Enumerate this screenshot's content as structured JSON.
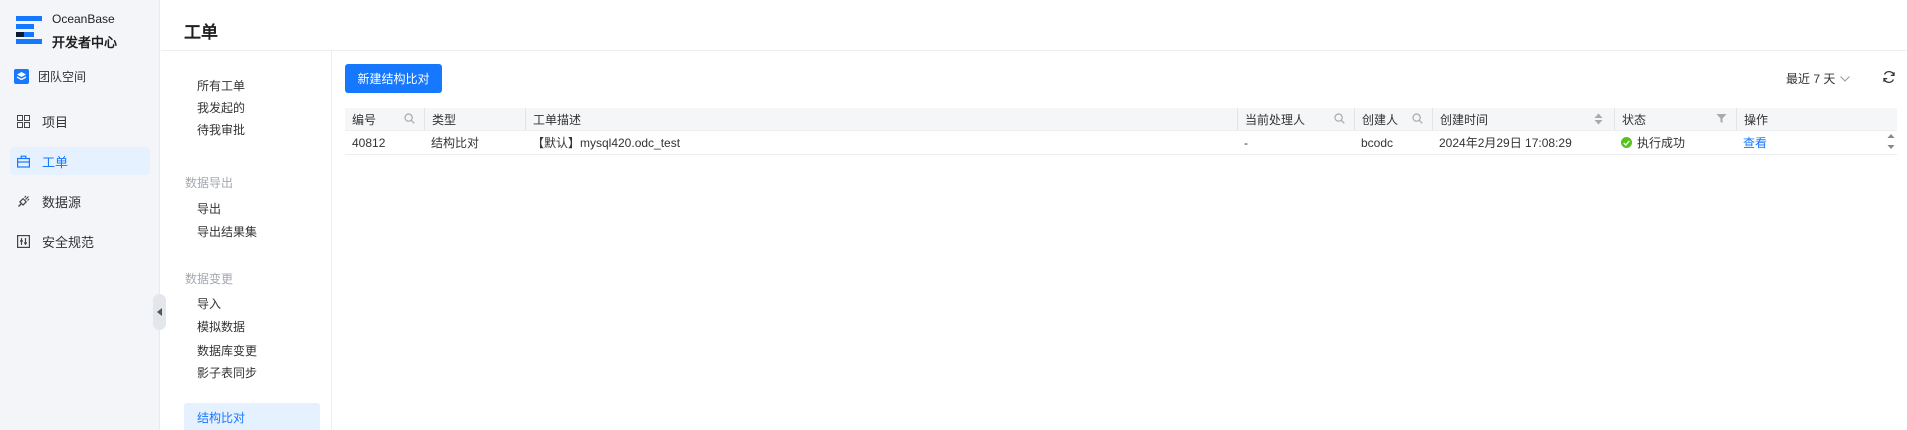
{
  "brand": {
    "line1": "OceanBase",
    "line2": "开发者中心"
  },
  "team": {
    "label": "团队空间",
    "icon": "team-icon"
  },
  "nav": [
    {
      "label": "项目",
      "icon": "grid-icon",
      "active": false
    },
    {
      "label": "工单",
      "icon": "briefcase-icon",
      "active": true
    },
    {
      "label": "数据源",
      "icon": "plug-icon",
      "active": false
    },
    {
      "label": "安全规范",
      "icon": "rule-icon",
      "active": false
    }
  ],
  "page": {
    "title": "工单"
  },
  "subnav": {
    "items_top": [
      "所有工单",
      "我发起的",
      "待我审批"
    ],
    "group_export": {
      "title": "数据导出",
      "items": [
        "导出",
        "导出结果集"
      ]
    },
    "group_change": {
      "title": "数据变更",
      "items": [
        "导入",
        "模拟数据",
        "数据库变更",
        "影子表同步",
        "结构比对"
      ]
    },
    "active": "结构比对"
  },
  "toolbar": {
    "create_button": "新建结构比对",
    "range_label": "最近 7 天",
    "refresh_icon": "refresh-icon"
  },
  "table": {
    "columns": [
      "编号",
      "类型",
      "工单描述",
      "当前处理人",
      "创建人",
      "创建时间",
      "状态",
      "操作"
    ],
    "rows": [
      {
        "id": "40812",
        "type": "结构比对",
        "description": "【默认】mysql420.odc_test",
        "handler": "-",
        "creator": "bcodc",
        "created_at": "2024年2月29日 17:08:29",
        "status": "执行成功",
        "action": "查看"
      }
    ]
  },
  "colors": {
    "accent": "#1677ff",
    "success": "#52c41a",
    "sidebar_bg": "#f3f5f8",
    "active_bg": "#e6f1ff"
  }
}
